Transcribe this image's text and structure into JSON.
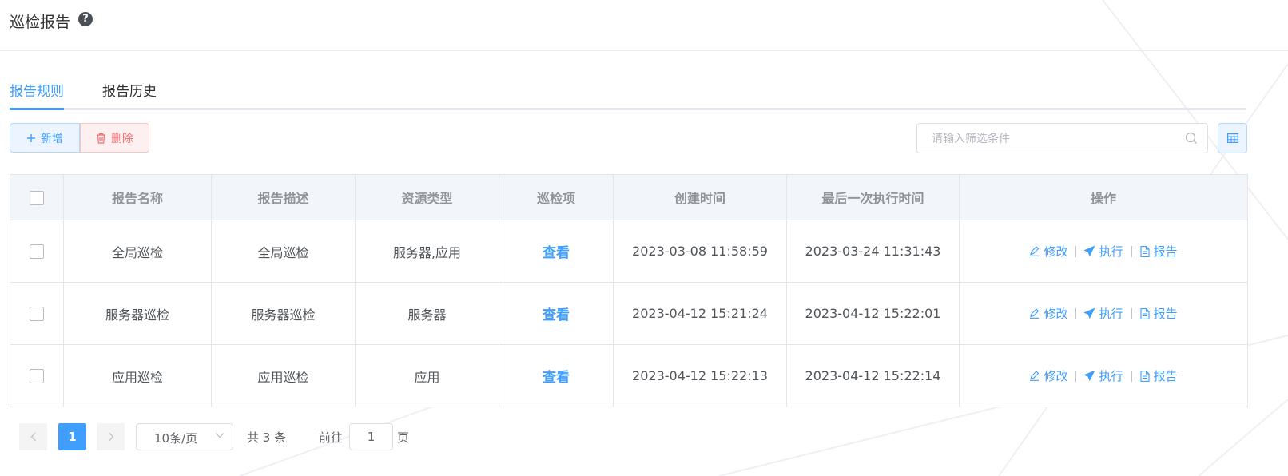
{
  "page": {
    "title": "巡检报告",
    "help_icon": "?"
  },
  "tabs": [
    {
      "label": "报告规则",
      "active": true
    },
    {
      "label": "报告历史",
      "active": false
    }
  ],
  "toolbar": {
    "add_label": "新增",
    "add_icon": "plus-icon",
    "delete_label": "删除",
    "delete_icon": "trash-icon",
    "search_placeholder": "请输入筛选条件",
    "column_toggle_icon": "table-columns-icon"
  },
  "table": {
    "headers": [
      "报告名称",
      "报告描述",
      "资源类型",
      "巡检项",
      "创建时间",
      "最后一次执行时间",
      "操作"
    ],
    "rows": [
      {
        "name": "全局巡检",
        "desc": "全局巡检",
        "type": "服务器,应用",
        "items": "查看",
        "created": "2023-03-08 11:58:59",
        "last_run": "2023-03-24 11:31:43"
      },
      {
        "name": "服务器巡检",
        "desc": "服务器巡检",
        "type": "服务器",
        "items": "查看",
        "created": "2023-04-12 15:21:24",
        "last_run": "2023-04-12 15:22:01"
      },
      {
        "name": "应用巡检",
        "desc": "应用巡检",
        "type": "应用",
        "items": "查看",
        "created": "2023-04-12 15:22:13",
        "last_run": "2023-04-12 15:22:14"
      }
    ],
    "actions": {
      "edit": "修改",
      "run": "执行",
      "report": "报告"
    }
  },
  "pagination": {
    "current_page": "1",
    "page_size": "10条/页",
    "total": "共 3 条",
    "goto_label": "前往",
    "goto_value": "1",
    "page_suffix": "页"
  },
  "colors": {
    "accent": "#409eff",
    "danger": "#f56c6c",
    "header_bg": "#f2f5f9"
  }
}
